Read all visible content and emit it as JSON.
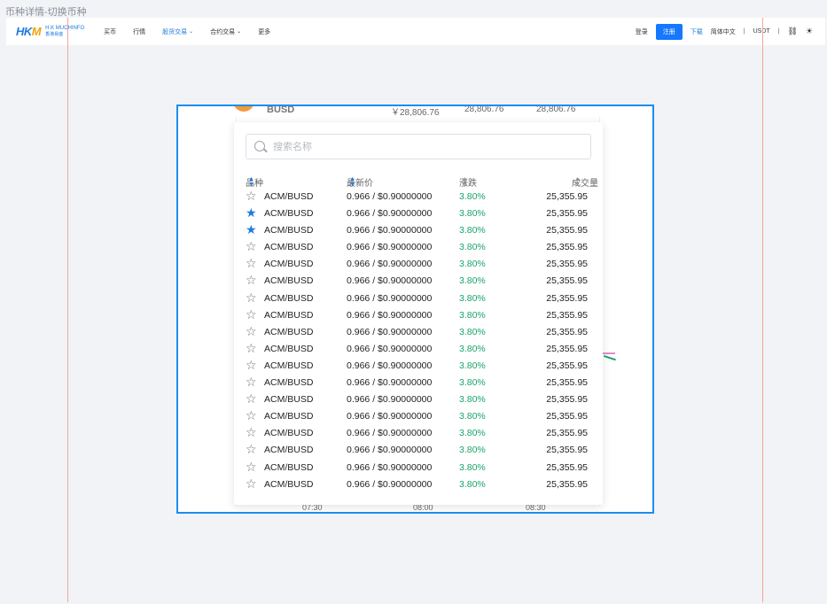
{
  "page_caption": "币种详情-切换币种",
  "navbar": {
    "logo_mark": "HKM",
    "logo_en": "H.K MUCHINFO",
    "logo_cn": "香港易盛",
    "menu": [
      {
        "label": "买币",
        "active": false,
        "dropdown": false
      },
      {
        "label": "行情",
        "active": false,
        "dropdown": false
      },
      {
        "label": "股货交易",
        "active": true,
        "dropdown": true
      },
      {
        "label": "合约交易",
        "active": false,
        "dropdown": true
      },
      {
        "label": "更多",
        "active": false,
        "dropdown": false
      }
    ],
    "login": "登录",
    "register": "注册",
    "download": "下载",
    "language": "简体中文",
    "currency": "USDT",
    "divider": "|",
    "link_icon": "link-icon",
    "theme_icon": "sun-icon"
  },
  "background": {
    "coin": "BUSD",
    "prices": [
      "￥28,806.76",
      "28,806.76",
      "28,806.76"
    ],
    "time_ticks": [
      "07:30",
      "08:00",
      "08:30"
    ]
  },
  "panel": {
    "search_placeholder": "搜索名称",
    "columns": {
      "symbol": "品种",
      "last_price": "最新价",
      "change": "涨跌",
      "volume": "成交量"
    },
    "rows": [
      {
        "favorite": false,
        "pair": "ACM/BUSD",
        "price": "0.966 / $0.90000000",
        "change": "3.80%",
        "volume": "25,355.95"
      },
      {
        "favorite": true,
        "pair": "ACM/BUSD",
        "price": "0.966 / $0.90000000",
        "change": "3.80%",
        "volume": "25,355.95"
      },
      {
        "favorite": true,
        "pair": "ACM/BUSD",
        "price": "0.966 / $0.90000000",
        "change": "3.80%",
        "volume": "25,355.95"
      },
      {
        "favorite": false,
        "pair": "ACM/BUSD",
        "price": "0.966 / $0.90000000",
        "change": "3.80%",
        "volume": "25,355.95"
      },
      {
        "favorite": false,
        "pair": "ACM/BUSD",
        "price": "0.966 / $0.90000000",
        "change": "3.80%",
        "volume": "25,355.95"
      },
      {
        "favorite": false,
        "pair": "ACM/BUSD",
        "price": "0.966 / $0.90000000",
        "change": "3.80%",
        "volume": "25,355.95"
      },
      {
        "favorite": false,
        "pair": "ACM/BUSD",
        "price": "0.966 / $0.90000000",
        "change": "3.80%",
        "volume": "25,355.95"
      },
      {
        "favorite": false,
        "pair": "ACM/BUSD",
        "price": "0.966 / $0.90000000",
        "change": "3.80%",
        "volume": "25,355.95"
      },
      {
        "favorite": false,
        "pair": "ACM/BUSD",
        "price": "0.966 / $0.90000000",
        "change": "3.80%",
        "volume": "25,355.95"
      },
      {
        "favorite": false,
        "pair": "ACM/BUSD",
        "price": "0.966 / $0.90000000",
        "change": "3.80%",
        "volume": "25,355.95"
      },
      {
        "favorite": false,
        "pair": "ACM/BUSD",
        "price": "0.966 / $0.90000000",
        "change": "3.80%",
        "volume": "25,355.95"
      },
      {
        "favorite": false,
        "pair": "ACM/BUSD",
        "price": "0.966 / $0.90000000",
        "change": "3.80%",
        "volume": "25,355.95"
      },
      {
        "favorite": false,
        "pair": "ACM/BUSD",
        "price": "0.966 / $0.90000000",
        "change": "3.80%",
        "volume": "25,355.95"
      },
      {
        "favorite": false,
        "pair": "ACM/BUSD",
        "price": "0.966 / $0.90000000",
        "change": "3.80%",
        "volume": "25,355.95"
      },
      {
        "favorite": false,
        "pair": "ACM/BUSD",
        "price": "0.966 / $0.90000000",
        "change": "3.80%",
        "volume": "25,355.95"
      },
      {
        "favorite": false,
        "pair": "ACM/BUSD",
        "price": "0.966 / $0.90000000",
        "change": "3.80%",
        "volume": "25,355.95"
      },
      {
        "favorite": false,
        "pair": "ACM/BUSD",
        "price": "0.966 / $0.90000000",
        "change": "3.80%",
        "volume": "25,355.95"
      },
      {
        "favorite": false,
        "pair": "ACM/BUSD",
        "price": "0.966 / $0.90000000",
        "change": "3.80%",
        "volume": "25,355.95"
      }
    ]
  },
  "colors": {
    "accent": "#1677ff",
    "up_green": "#1aa46b",
    "frame_border": "#1a8ef2",
    "guide_line": "#f2a59a"
  }
}
